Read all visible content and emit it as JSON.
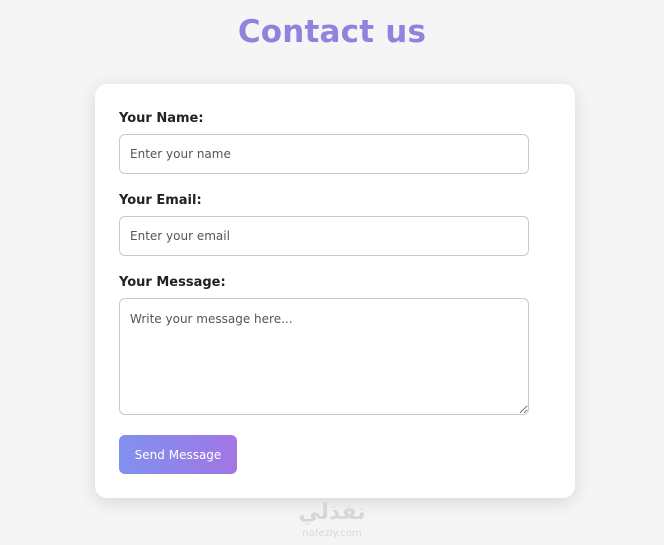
{
  "page": {
    "title": "Contact us"
  },
  "form": {
    "name_label": "Your Name:",
    "name_placeholder": "Enter your name",
    "email_label": "Your Email:",
    "email_placeholder": "Enter your email",
    "message_label": "Your Message:",
    "message_placeholder": "Write your message here...",
    "submit_label": "Send Message"
  },
  "watermark": {
    "arabic": "نفذلي",
    "latin": "nafezly.com"
  },
  "colors": {
    "title": "#8f83dd",
    "button_gradient_start": "#7f91ee",
    "button_gradient_end": "#a276e4",
    "background": "#f5f5f6",
    "card": "#ffffff"
  }
}
